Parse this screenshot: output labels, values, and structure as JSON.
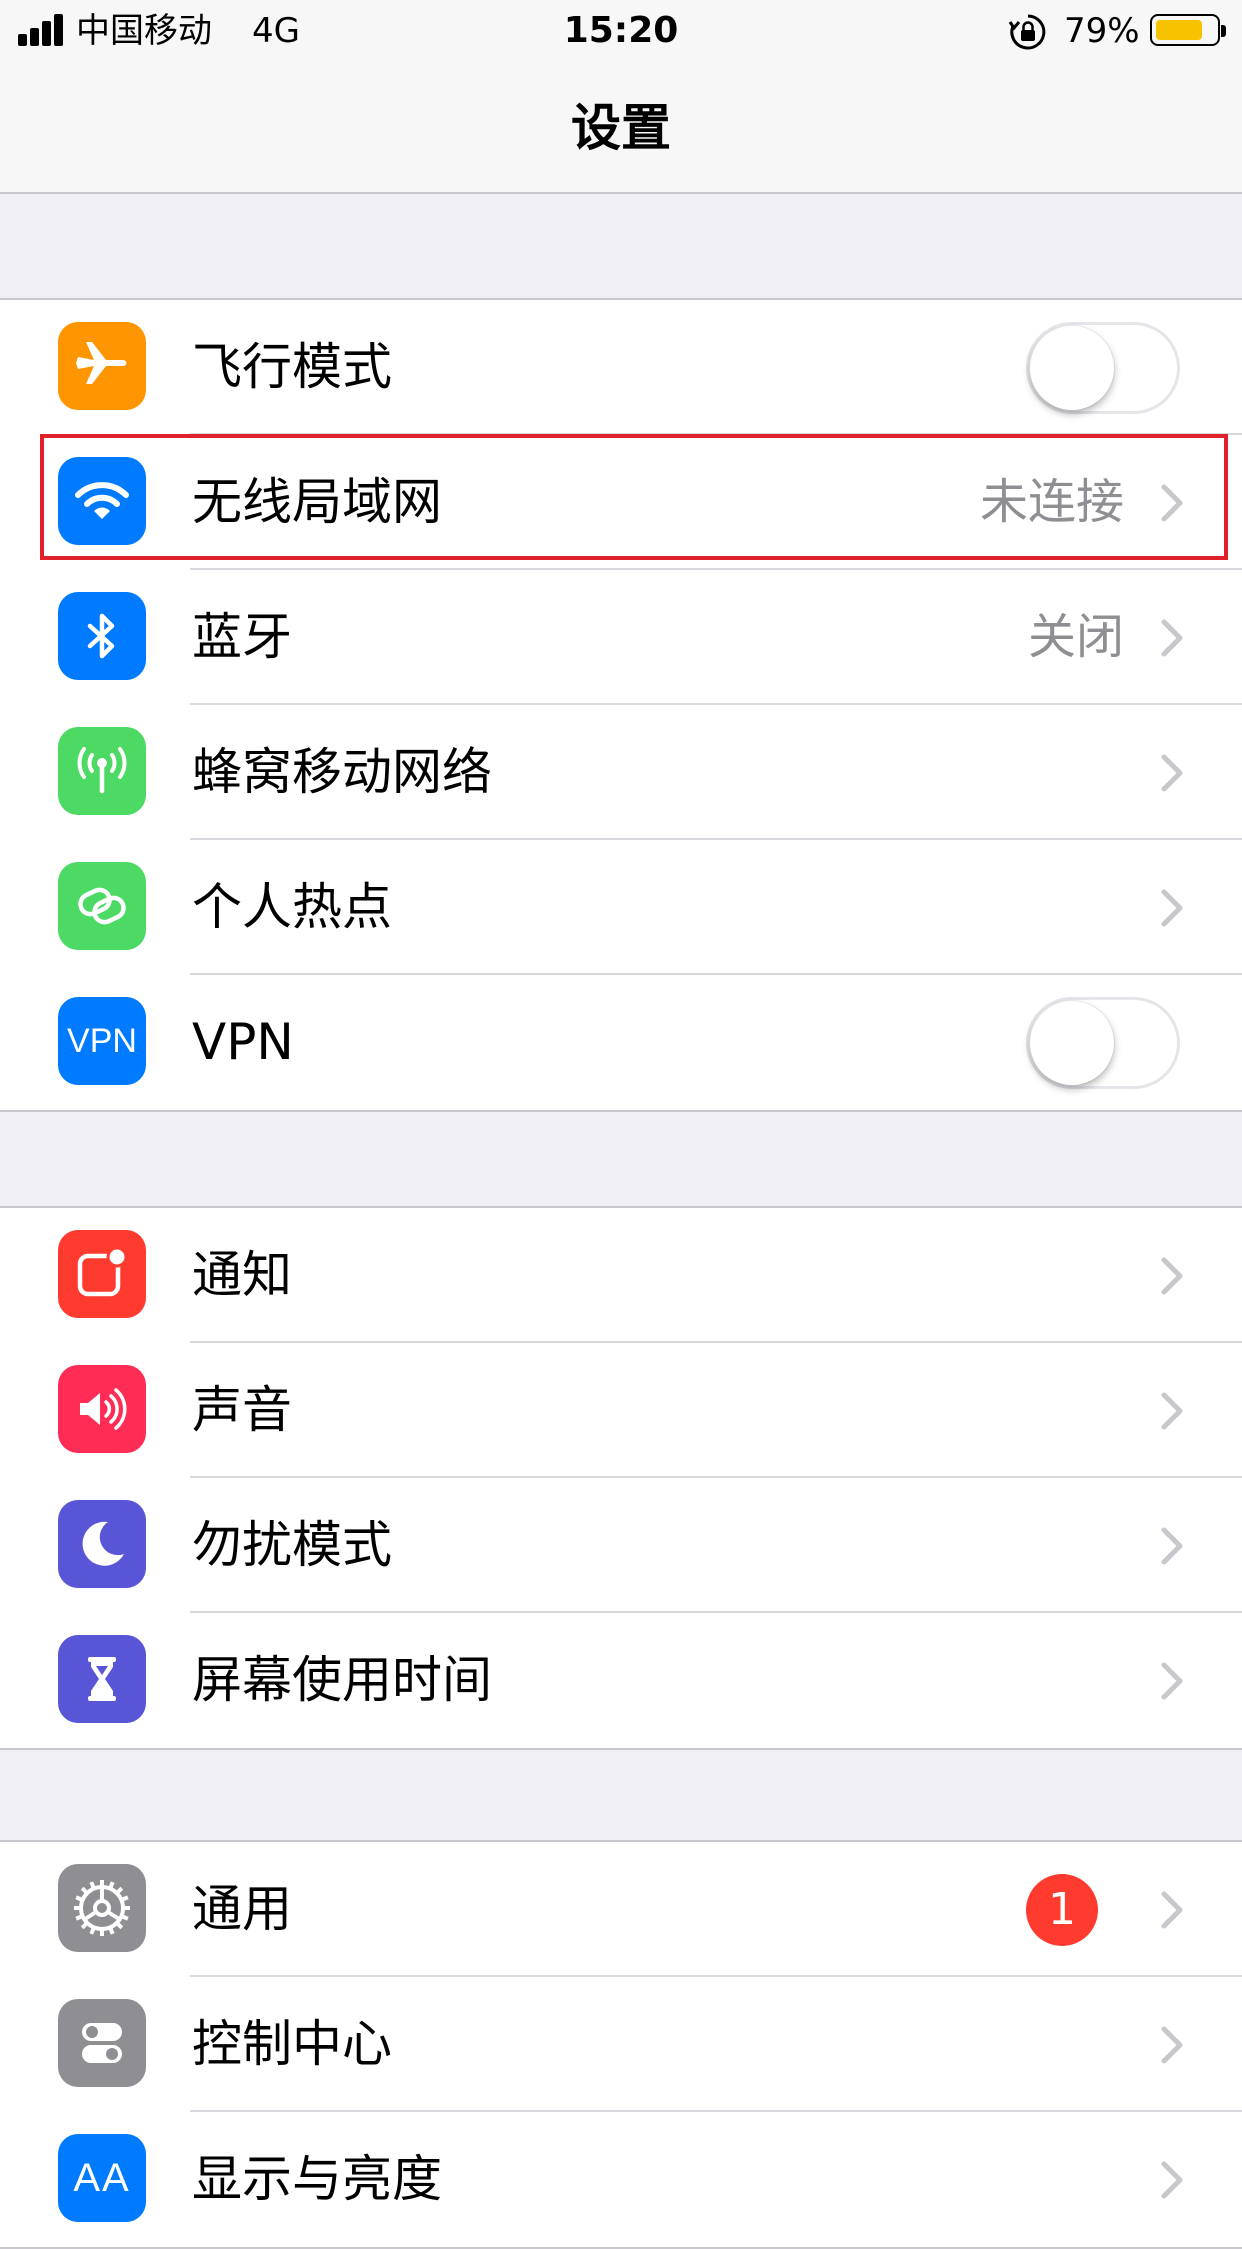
{
  "status_bar": {
    "carrier": "中国移动",
    "network": "4G",
    "time": "15:20",
    "battery_percent": "79%",
    "battery_level": 0.79,
    "battery_color": "#f7c200"
  },
  "nav": {
    "title": "设置"
  },
  "groups": [
    {
      "rows": [
        {
          "label": "飞行模式",
          "icon": "airplane-icon",
          "icon_color": "#ff9500",
          "control": "toggle",
          "on": false
        },
        {
          "label": "无线局域网",
          "icon": "wifi-icon",
          "icon_color": "#007aff",
          "value": "未连接",
          "control": "chevron",
          "highlighted": true
        },
        {
          "label": "蓝牙",
          "icon": "bluetooth-icon",
          "icon_color": "#007aff",
          "value": "关闭",
          "control": "chevron"
        },
        {
          "label": "蜂窝移动网络",
          "icon": "cellular-antenna-icon",
          "icon_color": "#4cd964",
          "control": "chevron"
        },
        {
          "label": "个人热点",
          "icon": "hotspot-icon",
          "icon_color": "#4cd964",
          "control": "chevron"
        },
        {
          "label": "VPN",
          "icon": "vpn-icon",
          "icon_text": "VPN",
          "icon_color": "#007aff",
          "control": "toggle",
          "on": false
        }
      ]
    },
    {
      "rows": [
        {
          "label": "通知",
          "icon": "notifications-icon",
          "icon_color": "#ff3b30",
          "control": "chevron"
        },
        {
          "label": "声音",
          "icon": "speaker-icon",
          "icon_color": "#ff2d55",
          "control": "chevron"
        },
        {
          "label": "勿扰模式",
          "icon": "moon-icon",
          "icon_color": "#5856d6",
          "control": "chevron"
        },
        {
          "label": "屏幕使用时间",
          "icon": "hourglass-icon",
          "icon_color": "#5856d6",
          "control": "chevron"
        }
      ]
    },
    {
      "rows": [
        {
          "label": "通用",
          "icon": "gear-icon",
          "icon_color": "#8e8e93",
          "badge": "1",
          "control": "chevron"
        },
        {
          "label": "控制中心",
          "icon": "switches-icon",
          "icon_color": "#8e8e93",
          "control": "chevron"
        },
        {
          "label": "显示与亮度",
          "icon": "text-size-icon",
          "icon_text": "AA",
          "icon_color": "#007aff",
          "control": "chevron"
        }
      ]
    }
  ]
}
